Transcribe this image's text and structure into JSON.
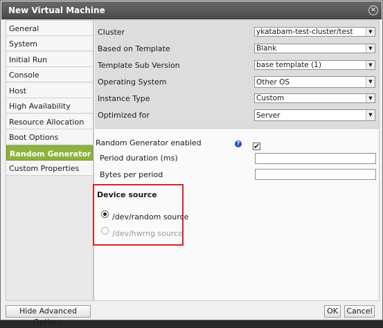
{
  "dialog": {
    "title": "New Virtual Machine",
    "close_icon": "close-icon"
  },
  "sidebar": {
    "items": [
      {
        "label": "General"
      },
      {
        "label": "System"
      },
      {
        "label": "Initial Run"
      },
      {
        "label": "Console"
      },
      {
        "label": "Host"
      },
      {
        "label": "High Availability"
      },
      {
        "label": "Resource Allocation"
      },
      {
        "label": "Boot Options"
      },
      {
        "label": "Random Generator",
        "selected": true
      },
      {
        "label": "Custom Properties"
      }
    ]
  },
  "form": {
    "cluster": {
      "label": "Cluster",
      "value": "ykatabam-test-cluster/test"
    },
    "template": {
      "label": "Based on Template",
      "value": "Blank"
    },
    "sub_version": {
      "label": "Template Sub Version",
      "value": "base template (1)"
    },
    "os": {
      "label": "Operating System",
      "value": "Other OS"
    },
    "instance_type": {
      "label": "Instance Type",
      "value": "Custom"
    },
    "optimized_for": {
      "label": "Optimized for",
      "value": "Server"
    }
  },
  "random_generator": {
    "enabled_label": "Random Generator enabled",
    "enabled": true,
    "help_icon": "help-icon",
    "period_label": "Period duration (ms)",
    "period_value": "",
    "bytes_label": "Bytes per period",
    "bytes_value": "",
    "device_source_title": "Device source",
    "options": [
      {
        "label": "/dev/random source",
        "selected": true,
        "enabled": true
      },
      {
        "label": "/dev/hwrng source",
        "selected": false,
        "enabled": false
      }
    ]
  },
  "footer": {
    "advanced_label": "Hide Advanced Options",
    "ok_label": "OK",
    "cancel_label": "Cancel"
  },
  "colors": {
    "selected_tab": "#8cb43c",
    "highlight_border": "#e02020",
    "help_icon": "#1f4fd1"
  }
}
